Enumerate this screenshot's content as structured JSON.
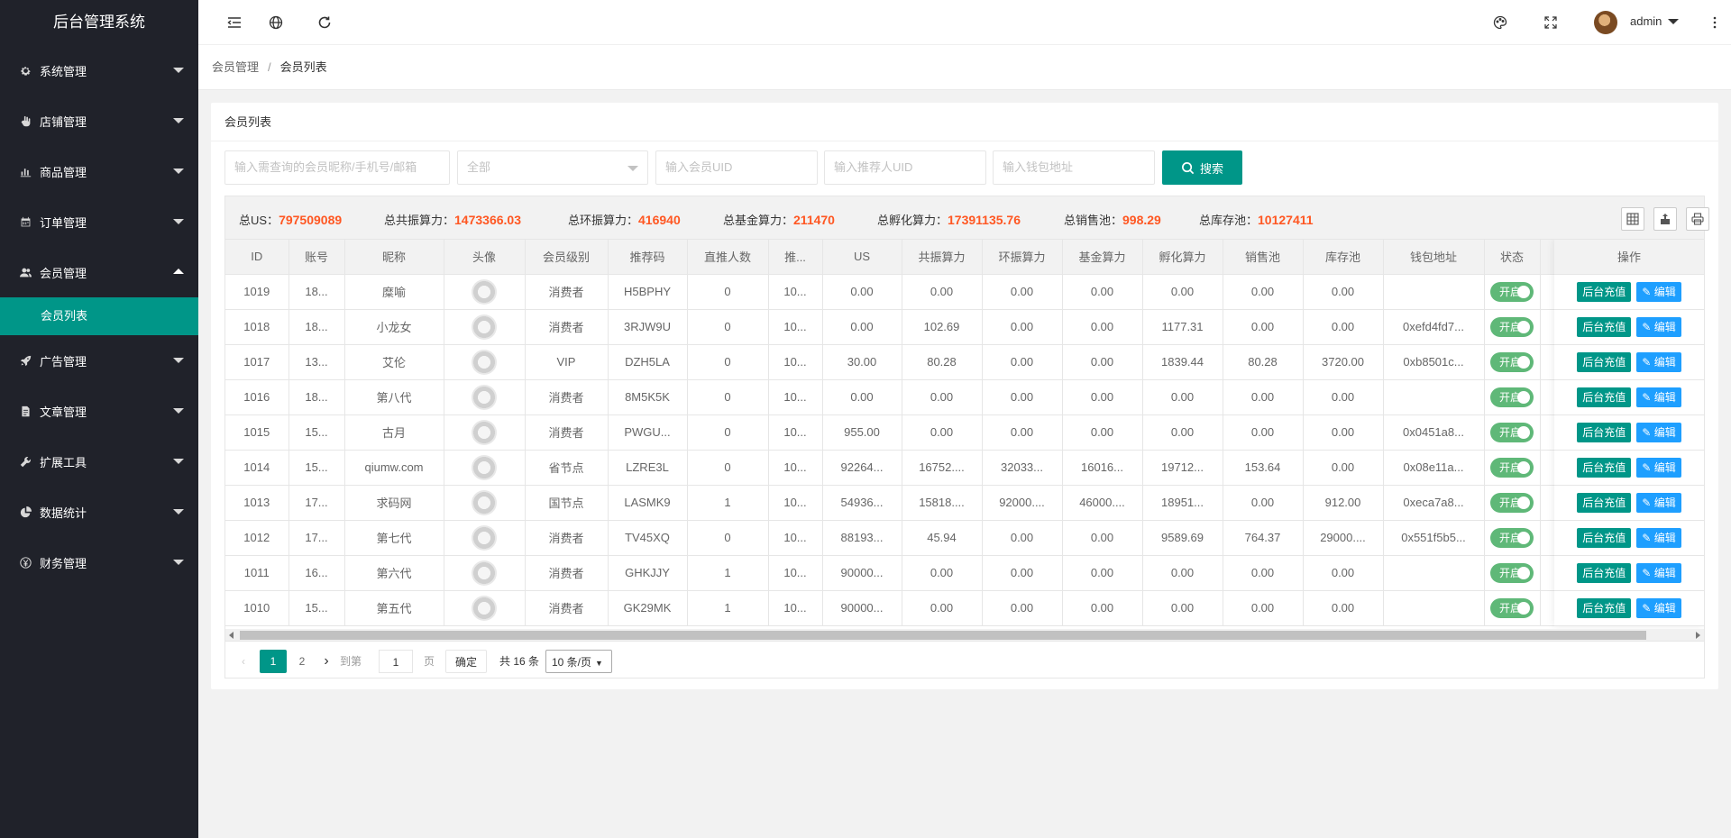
{
  "app_title": "后台管理系统",
  "sidebar": {
    "items": [
      {
        "label": "系统管理",
        "icon": "gear-icon"
      },
      {
        "label": "店铺管理",
        "icon": "hand-icon"
      },
      {
        "label": "商品管理",
        "icon": "bar-chart-icon"
      },
      {
        "label": "订单管理",
        "icon": "calendar-icon"
      },
      {
        "label": "会员管理",
        "icon": "users-icon",
        "expanded": true
      },
      {
        "label": "广告管理",
        "icon": "rocket-icon"
      },
      {
        "label": "文章管理",
        "icon": "document-icon"
      },
      {
        "label": "扩展工具",
        "icon": "wrench-icon"
      },
      {
        "label": "数据统计",
        "icon": "pie-chart-icon"
      },
      {
        "label": "财务管理",
        "icon": "yen-icon"
      }
    ],
    "sub_item": "会员列表"
  },
  "header": {
    "user_name": "admin"
  },
  "breadcrumb": {
    "parent": "会员管理",
    "separator": "/",
    "current": "会员列表"
  },
  "card_title": "会员列表",
  "search": {
    "keyword_placeholder": "输入需查询的会员昵称/手机号/邮箱",
    "level_select": "全部",
    "uid_placeholder": "输入会员UID",
    "referrer_placeholder": "输入推荐人UID",
    "wallet_placeholder": "输入钱包地址",
    "button": "搜索"
  },
  "totals": [
    {
      "label": "总US：",
      "value": "797509089"
    },
    {
      "label": "总共振算力：",
      "value": "1473366.03"
    },
    {
      "label": "总环振算力：",
      "value": "416940"
    },
    {
      "label": "总基金算力：",
      "value": "211470"
    },
    {
      "label": "总孵化算力：",
      "value": "17391135.76"
    },
    {
      "label": "总销售池：",
      "value": "998.29"
    },
    {
      "label": "总库存池：",
      "value": "10127411"
    }
  ],
  "table": {
    "headers": [
      "ID",
      "账号",
      "昵称",
      "头像",
      "会员级别",
      "推荐码",
      "直推人数",
      "推...",
      "US",
      "共振算力",
      "环振算力",
      "基金算力",
      "孵化算力",
      "销售池",
      "库存池",
      "钱包地址",
      "状态"
    ],
    "action_header": "操作",
    "charge_label": "后台充值",
    "edit_label": "编辑",
    "status_label": "开启",
    "rows": [
      [
        "1019",
        "18...",
        "糜喻",
        "",
        "消费者",
        "H5BPHY",
        "0",
        "10...",
        "0.00",
        "0.00",
        "0.00",
        "0.00",
        "0.00",
        "0.00",
        "0.00",
        ""
      ],
      [
        "1018",
        "18...",
        "小龙女",
        "",
        "消费者",
        "3RJW9U",
        "0",
        "10...",
        "0.00",
        "102.69",
        "0.00",
        "0.00",
        "1177.31",
        "0.00",
        "0.00",
        "0xefd4fd7..."
      ],
      [
        "1017",
        "13...",
        "艾伦",
        "",
        "VIP",
        "DZH5LA",
        "0",
        "10...",
        "30.00",
        "80.28",
        "0.00",
        "0.00",
        "1839.44",
        "80.28",
        "3720.00",
        "0xb8501c..."
      ],
      [
        "1016",
        "18...",
        "第八代",
        "",
        "消费者",
        "8M5K5K",
        "0",
        "10...",
        "0.00",
        "0.00",
        "0.00",
        "0.00",
        "0.00",
        "0.00",
        "0.00",
        ""
      ],
      [
        "1015",
        "15...",
        "古月",
        "",
        "消费者",
        "PWGU...",
        "0",
        "10...",
        "955.00",
        "0.00",
        "0.00",
        "0.00",
        "0.00",
        "0.00",
        "0.00",
        "0x0451a8..."
      ],
      [
        "1014",
        "15...",
        "qiumw.com",
        "",
        "省节点",
        "LZRE3L",
        "0",
        "10...",
        "92264...",
        "16752....",
        "32033...",
        "16016...",
        "19712...",
        "153.64",
        "0.00",
        "0x08e11a..."
      ],
      [
        "1013",
        "17...",
        "求码网",
        "",
        "国节点",
        "LASMK9",
        "1",
        "10...",
        "54936...",
        "15818....",
        "92000....",
        "46000....",
        "18951...",
        "0.00",
        "912.00",
        "0xeca7a8..."
      ],
      [
        "1012",
        "17...",
        "第七代",
        "",
        "消费者",
        "TV45XQ",
        "0",
        "10...",
        "88193...",
        "45.94",
        "0.00",
        "0.00",
        "9589.69",
        "764.37",
        "29000....",
        "0x551f5b5..."
      ],
      [
        "1011",
        "16...",
        "第六代",
        "",
        "消费者",
        "GHKJJY",
        "1",
        "10...",
        "90000...",
        "0.00",
        "0.00",
        "0.00",
        "0.00",
        "0.00",
        "0.00",
        ""
      ],
      [
        "1010",
        "15...",
        "第五代",
        "",
        "消费者",
        "GK29MK",
        "1",
        "10...",
        "90000...",
        "0.00",
        "0.00",
        "0.00",
        "0.00",
        "0.00",
        "0.00",
        ""
      ]
    ]
  },
  "pagination": {
    "pages": [
      "1",
      "2"
    ],
    "goto_label": "到第",
    "goto_value": "1",
    "page_unit": "页",
    "confirm": "确定",
    "total": "共 16 条",
    "page_size": "10 条/页"
  },
  "colors": {
    "sidebar_bg": "#20222a",
    "accent": "#009688",
    "highlight": "#ff5722",
    "edit_blue": "#1e9fff",
    "switch_green": "#5fb878"
  }
}
